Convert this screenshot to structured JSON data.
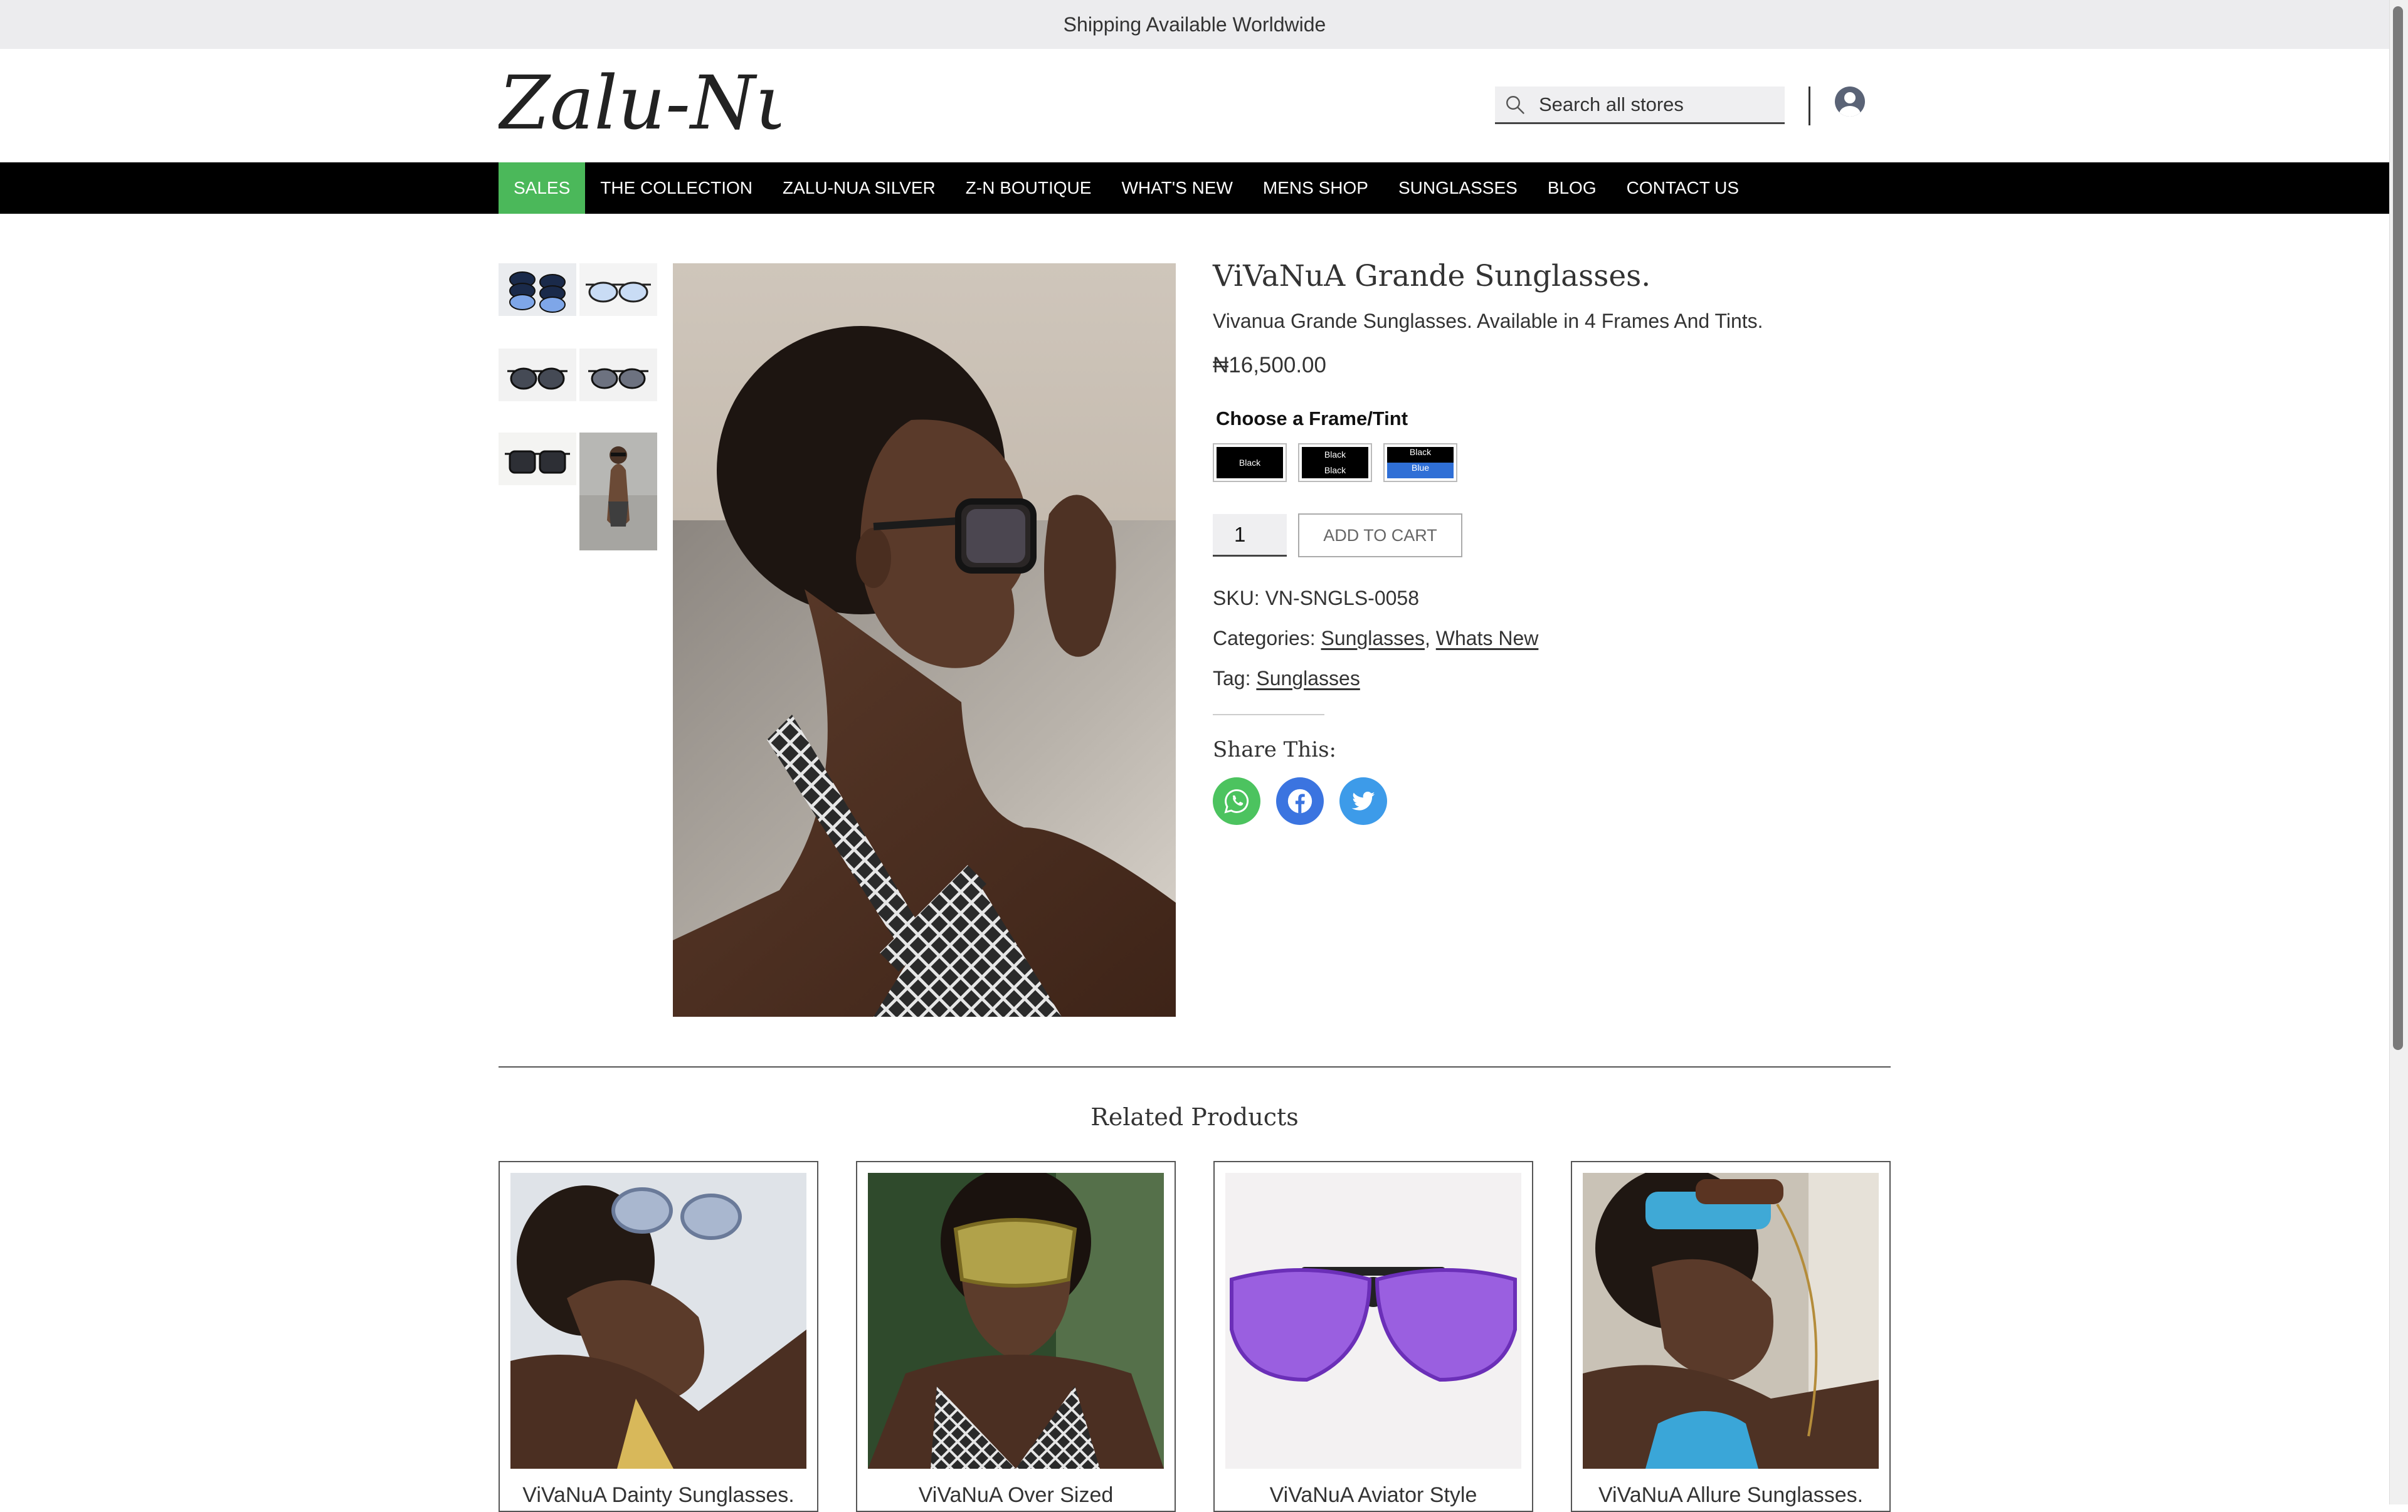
{
  "announcement": "Shipping Available Worldwide",
  "logo_text": "Zalu-Nua",
  "search": {
    "placeholder": "Search all stores"
  },
  "nav": {
    "items": [
      "SALES",
      "THE COLLECTION",
      "ZALU-NUA SILVER",
      "Z-N BOUTIQUE",
      "WHAT'S NEW",
      "MENS SHOP",
      "SUNGLASSES",
      "BLOG",
      "CONTACT US"
    ],
    "active": "SALES"
  },
  "product": {
    "title": "ViVaNuA Grande Sunglasses.",
    "description": "Vivanua Grande Sunglasses. Available in 4 Frames And Tints.",
    "price": "₦16,500.00",
    "variant_label": "Choose a Frame/Tint",
    "swatches": [
      {
        "top": "Black",
        "bottom": ""
      },
      {
        "top": "Black",
        "bottom": "Black"
      },
      {
        "top": "Black",
        "bottom": "Blue"
      }
    ],
    "quantity": "1",
    "add_to_cart": "ADD TO CART",
    "sku_label": "SKU:",
    "sku": "VN-SNGLS-0058",
    "categories_label": "Categories:",
    "categories": [
      "Sunglasses",
      "Whats New"
    ],
    "category_separator": ",",
    "tag_label": "Tag:",
    "tag": "Sunglasses",
    "share_label": "Share This:"
  },
  "related": {
    "title": "Related Products",
    "items": [
      "ViVaNuA Dainty Sunglasses.",
      "ViVaNuA Over Sized",
      "ViVaNuA Aviator Style",
      "ViVaNuA Allure Sunglasses."
    ]
  },
  "colors": {
    "nav_active": "#4bb85a",
    "whatsapp": "#4cc35f",
    "facebook": "#3b74e0",
    "twitter": "#3d9be9",
    "swatch_blue": "#2f6fd6"
  }
}
